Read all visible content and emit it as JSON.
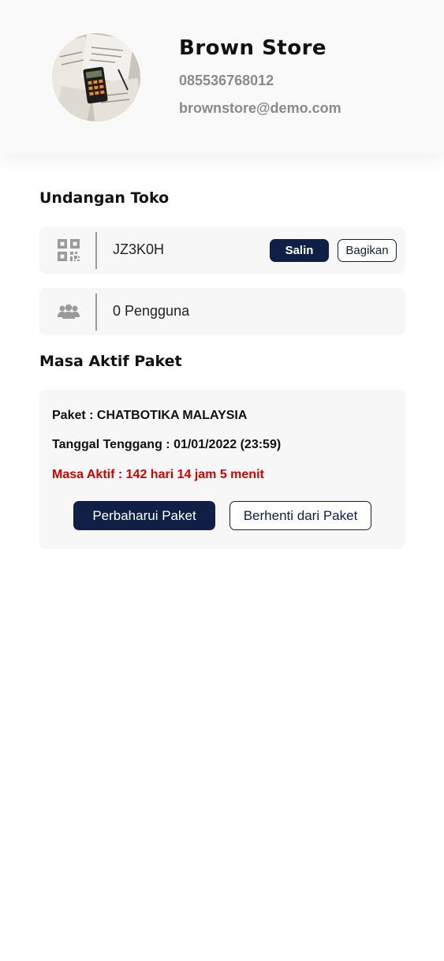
{
  "profile": {
    "store_name": "Brown Store",
    "phone": "085536768012",
    "email": "brownstore@demo.com",
    "avatar_icon": "store-avatar-photo"
  },
  "invite": {
    "title": "Undangan Toko",
    "code_icon": "qr-code-icon",
    "code": "JZ3K0H",
    "copy_label": "Salin",
    "share_label": "Bagikan",
    "users_icon": "users-group-icon",
    "users_text": "0 Pengguna"
  },
  "package": {
    "title": "Masa Aktif Paket",
    "name_line": "Paket : CHATBOTIKA MALAYSIA",
    "grace_line": "Tanggal Tenggang : 01/01/2022 (23:59)",
    "active_line": "Masa Aktif : 142 hari 14 jam 5 menit",
    "renew_label": "Perbaharui Paket",
    "stop_label": "Berhenti dari Paket"
  },
  "colors": {
    "primary": "#0f1f45",
    "danger": "#d40000",
    "muted": "#8a8a8a",
    "card": "#f7f7f7"
  }
}
